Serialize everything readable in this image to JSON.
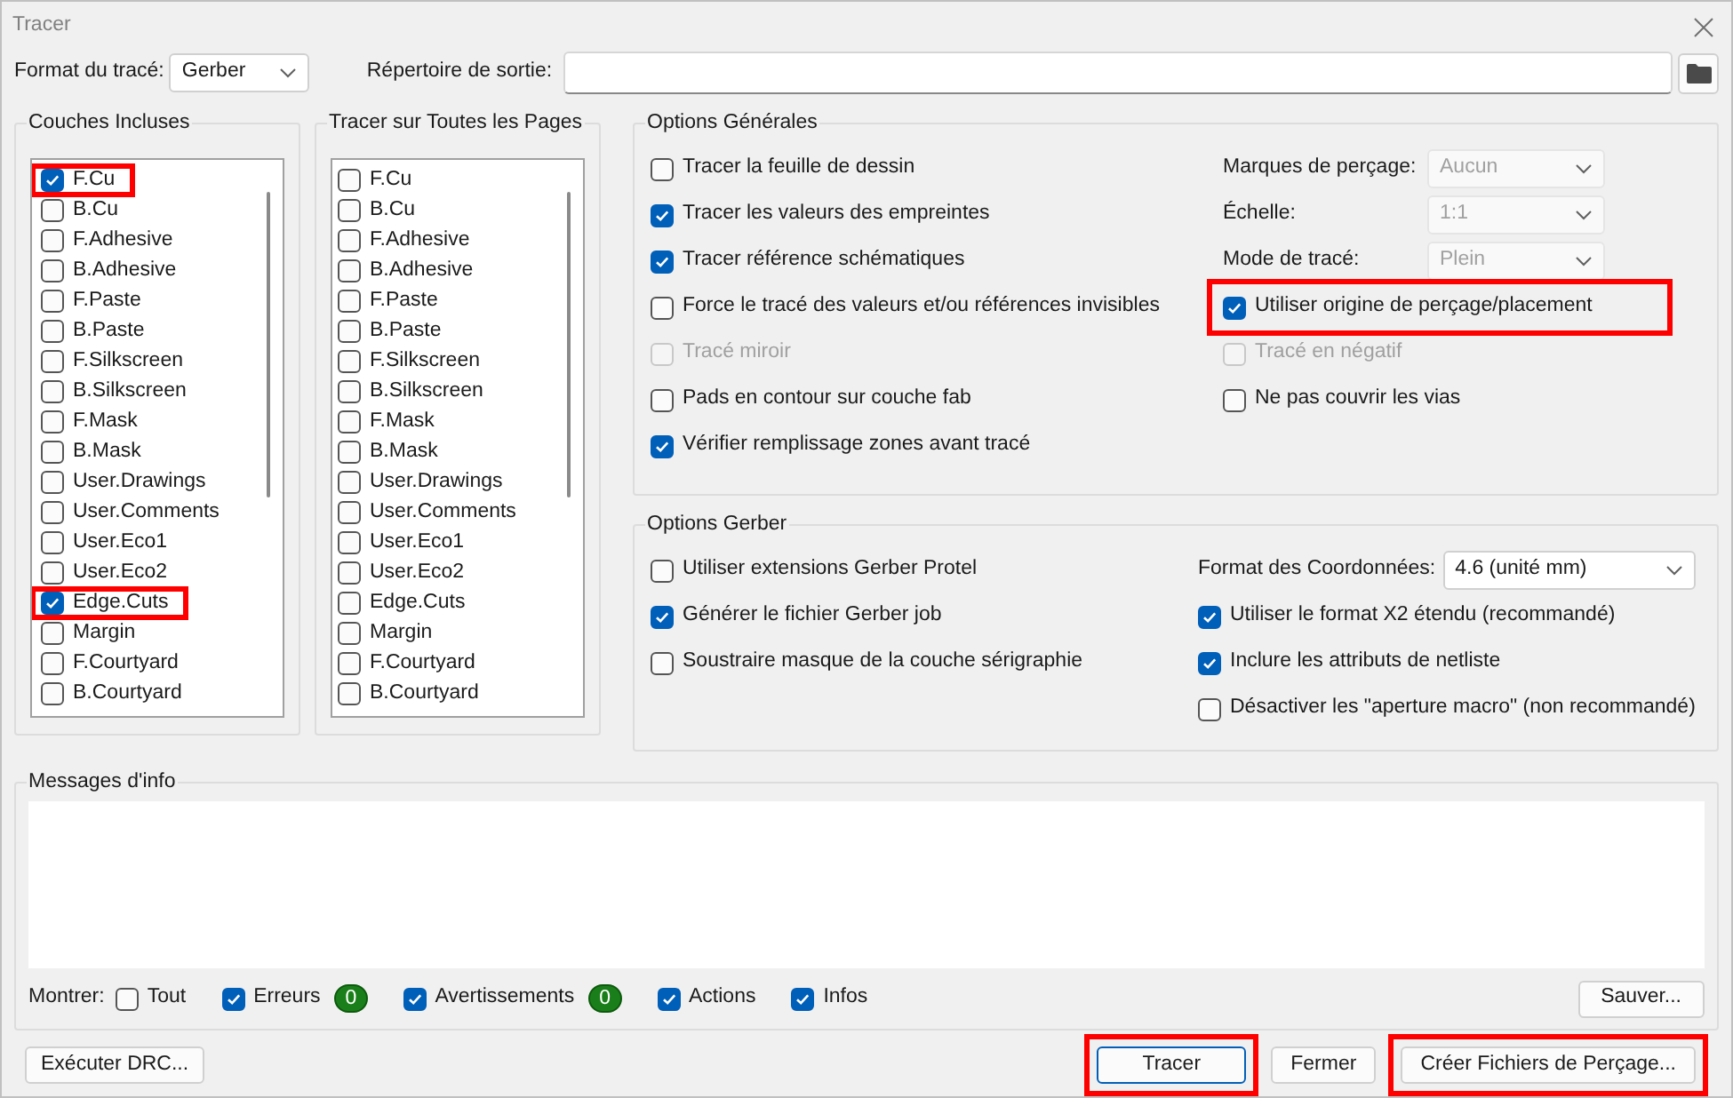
{
  "window": {
    "title": "Tracer"
  },
  "format": {
    "label": "Format du tracé:",
    "value": "Gerber"
  },
  "output_dir": {
    "label": "Répertoire de sortie:"
  },
  "layers_included": {
    "title": "Couches Incluses",
    "items": [
      {
        "label": "F.Cu",
        "checked": true,
        "highlighted": true
      },
      {
        "label": "B.Cu",
        "checked": false,
        "highlighted": false
      },
      {
        "label": "F.Adhesive",
        "checked": false,
        "highlighted": false
      },
      {
        "label": "B.Adhesive",
        "checked": false,
        "highlighted": false
      },
      {
        "label": "F.Paste",
        "checked": false,
        "highlighted": false
      },
      {
        "label": "B.Paste",
        "checked": false,
        "highlighted": false
      },
      {
        "label": "F.Silkscreen",
        "checked": false,
        "highlighted": false
      },
      {
        "label": "B.Silkscreen",
        "checked": false,
        "highlighted": false
      },
      {
        "label": "F.Mask",
        "checked": false,
        "highlighted": false
      },
      {
        "label": "B.Mask",
        "checked": false,
        "highlighted": false
      },
      {
        "label": "User.Drawings",
        "checked": false,
        "highlighted": false
      },
      {
        "label": "User.Comments",
        "checked": false,
        "highlighted": false
      },
      {
        "label": "User.Eco1",
        "checked": false,
        "highlighted": false
      },
      {
        "label": "User.Eco2",
        "checked": false,
        "highlighted": false
      },
      {
        "label": "Edge.Cuts",
        "checked": true,
        "highlighted": true
      },
      {
        "label": "Margin",
        "checked": false,
        "highlighted": false
      },
      {
        "label": "F.Courtyard",
        "checked": false,
        "highlighted": false
      },
      {
        "label": "B.Courtyard",
        "checked": false,
        "highlighted": false
      }
    ]
  },
  "all_pages": {
    "title": "Tracer sur Toutes les Pages",
    "items": [
      {
        "label": "F.Cu",
        "checked": false
      },
      {
        "label": "B.Cu",
        "checked": false
      },
      {
        "label": "F.Adhesive",
        "checked": false
      },
      {
        "label": "B.Adhesive",
        "checked": false
      },
      {
        "label": "F.Paste",
        "checked": false
      },
      {
        "label": "B.Paste",
        "checked": false
      },
      {
        "label": "F.Silkscreen",
        "checked": false
      },
      {
        "label": "B.Silkscreen",
        "checked": false
      },
      {
        "label": "F.Mask",
        "checked": false
      },
      {
        "label": "B.Mask",
        "checked": false
      },
      {
        "label": "User.Drawings",
        "checked": false
      },
      {
        "label": "User.Comments",
        "checked": false
      },
      {
        "label": "User.Eco1",
        "checked": false
      },
      {
        "label": "User.Eco2",
        "checked": false
      },
      {
        "label": "Edge.Cuts",
        "checked": false
      },
      {
        "label": "Margin",
        "checked": false
      },
      {
        "label": "F.Courtyard",
        "checked": false
      },
      {
        "label": "B.Courtyard",
        "checked": false
      }
    ]
  },
  "general_options": {
    "title": "Options Générales",
    "checks": [
      {
        "label": "Tracer la feuille de dessin",
        "checked": false,
        "disabled": false
      },
      {
        "label": "Tracer les valeurs des empreintes",
        "checked": true,
        "disabled": false
      },
      {
        "label": "Tracer référence  schématiques",
        "checked": true,
        "disabled": false
      },
      {
        "label": "Force le tracé des valeurs et/ou références invisibles",
        "checked": false,
        "disabled": false
      },
      {
        "label": "Tracé miroir",
        "checked": false,
        "disabled": true
      },
      {
        "label": "Pads en contour sur couche fab",
        "checked": false,
        "disabled": false
      },
      {
        "label": "Vérifier remplissage zones avant tracé",
        "checked": true,
        "disabled": false
      }
    ],
    "selects": [
      {
        "label": "Marques de perçage:",
        "value": "Aucun",
        "disabled": true
      },
      {
        "label": "Échelle:",
        "value": "1:1",
        "disabled": true
      },
      {
        "label": "Mode de tracé:",
        "value": "Plein",
        "disabled": true
      }
    ],
    "right_checks": [
      {
        "label": "Utiliser origine de perçage/placement",
        "checked": true,
        "disabled": false,
        "highlighted": true
      },
      {
        "label": "Tracé en négatif",
        "checked": false,
        "disabled": true,
        "highlighted": false
      },
      {
        "label": "Ne pas couvrir les vias",
        "checked": false,
        "disabled": false,
        "highlighted": false
      }
    ]
  },
  "gerber_options": {
    "title": "Options Gerber",
    "checks": [
      {
        "label": "Utiliser extensions Gerber Protel",
        "checked": false
      },
      {
        "label": "Générer le fichier Gerber job",
        "checked": true
      },
      {
        "label": "Soustraire masque de la couche sérigraphie",
        "checked": false
      }
    ],
    "coord_format": {
      "label": "Format des Coordonnées:",
      "value": "4.6 (unité mm)"
    },
    "right_checks": [
      {
        "label": "Utiliser le format X2 étendu (recommandé)",
        "checked": true
      },
      {
        "label": "Inclure les attributs de netliste",
        "checked": true
      },
      {
        "label": "Désactiver les \"aperture macro\" (non recommandé)",
        "checked": false
      }
    ]
  },
  "messages": {
    "title": "Messages d'info",
    "show_label": "Montrer:",
    "filters": [
      {
        "label": "Tout",
        "checked": false
      },
      {
        "label": "Erreurs",
        "checked": true,
        "count": "0"
      },
      {
        "label": "Avertissements",
        "checked": true,
        "count": "0"
      },
      {
        "label": "Actions",
        "checked": true
      },
      {
        "label": "Infos",
        "checked": true
      }
    ],
    "save_button": "Sauver..."
  },
  "drc_button": "Exécuter DRC...",
  "buttons": [
    {
      "label": "Tracer",
      "default": true,
      "highlighted": true
    },
    {
      "label": "Fermer",
      "default": false,
      "highlighted": false
    },
    {
      "label": "Créer Fichiers de Perçage...",
      "default": false,
      "highlighted": true
    }
  ]
}
